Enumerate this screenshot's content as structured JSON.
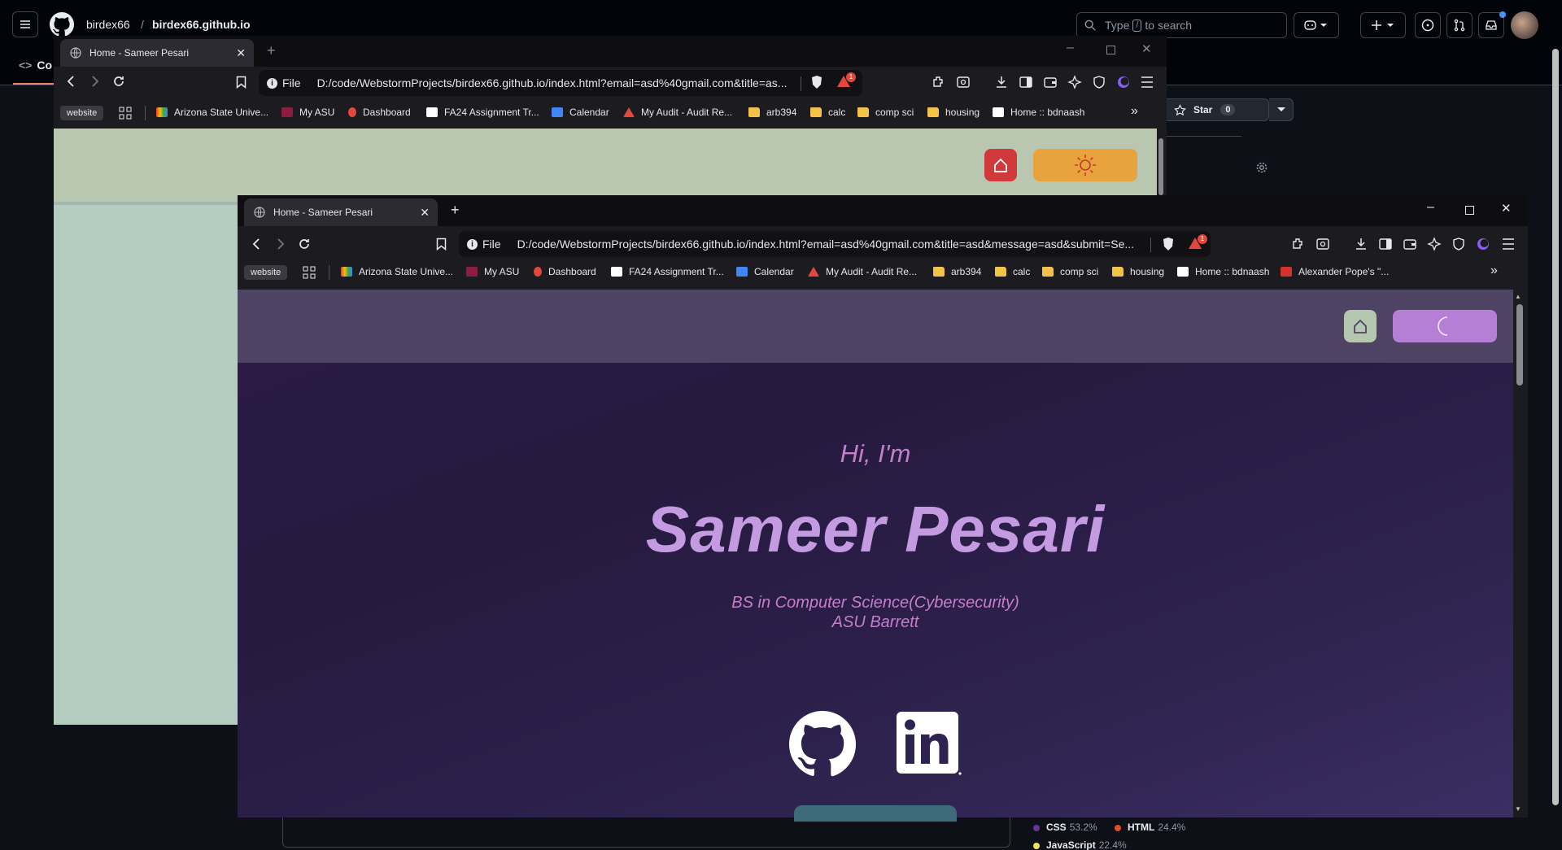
{
  "github": {
    "owner": "birdex66",
    "separator": "/",
    "repo": "birdex66.github.io",
    "search_pre": "Type",
    "search_slash": "/",
    "search_post": "to search",
    "code_tab": "Co",
    "star_label": "Star",
    "star_count": "0",
    "languages": [
      {
        "name": "CSS",
        "pct": "53.2%",
        "color": "#663399"
      },
      {
        "name": "HTML",
        "pct": "24.4%",
        "color": "#e34c26"
      },
      {
        "name": "JavaScript",
        "pct": "22.4%",
        "color": "#f1e05a"
      }
    ]
  },
  "browser_back": {
    "tab_title": "Home - Sameer Pesari",
    "file_label": "File",
    "url": "D:/code/WebstormProjects/birdex66.github.io/index.html?email=asd%40gmail.com&title=as...",
    "bookmarks": {
      "website": "website",
      "items": [
        "Arizona State Unive...",
        "My ASU",
        "Dashboard",
        "FA24 Assignment Tr...",
        "Calendar",
        "My Audit - Audit Re...",
        "arb394",
        "calc",
        "comp sci",
        "housing",
        "Home :: bdnaash"
      ]
    },
    "alert_count": "1"
  },
  "browser_front": {
    "tab_title": "Home - Sameer Pesari",
    "file_label": "File",
    "url": "D:/code/WebstormProjects/birdex66.github.io/index.html?email=asd%40gmail.com&title=asd&message=asd&submit=Se...",
    "bookmarks": {
      "website": "website",
      "items": [
        "Arizona State Unive...",
        "My ASU",
        "Dashboard",
        "FA24 Assignment Tr...",
        "Calendar",
        "My Audit - Audit Re...",
        "arb394",
        "calc",
        "comp sci",
        "housing",
        "Home :: bdnaash",
        "Alexander Pope's \"..."
      ]
    },
    "alert_count": "1"
  },
  "site": {
    "greeting": "Hi, I'm",
    "name": "Sameer Pesari",
    "degree": "BS in Computer Science(Cybersecurity)",
    "school": "ASU Barrett"
  }
}
